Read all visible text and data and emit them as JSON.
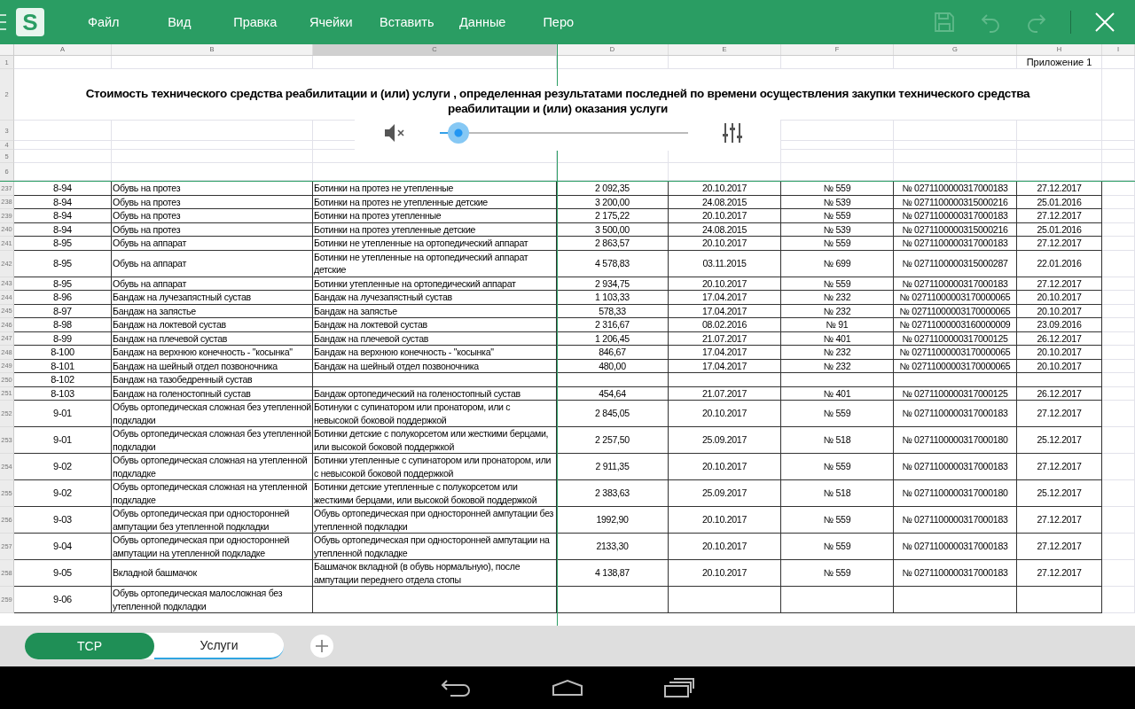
{
  "toolbar": {
    "logo": "S",
    "menu": [
      "Файл",
      "Вид",
      "Правка",
      "Ячейки",
      "Вставить",
      "Данные",
      "Перо"
    ],
    "actions": [
      {
        "kind": "save",
        "disabled": true
      },
      {
        "kind": "undo",
        "disabled": true
      },
      {
        "kind": "redo",
        "disabled": true
      },
      {
        "kind": "close",
        "disabled": false
      }
    ]
  },
  "sheet": {
    "columns": [
      {
        "label": "A",
        "selected": false
      },
      {
        "label": "B",
        "selected": false
      },
      {
        "label": "C",
        "selected": true
      },
      {
        "label": "D",
        "selected": false
      },
      {
        "label": "E",
        "selected": false
      },
      {
        "label": "F",
        "selected": false
      },
      {
        "label": "G",
        "selected": false
      },
      {
        "label": "H",
        "selected": false
      },
      {
        "label": "I",
        "selected": false
      }
    ],
    "top_rows": [
      "1",
      "2",
      "3",
      "4",
      "5",
      "6"
    ],
    "appendix_note": "Приложение 1",
    "title": "Стоимость технического средства реабилитации и (или) услуги , определенная результатами последней по времени осуществления закупки технического средства реабилитации и (или) оказания услуги",
    "rows": [
      {
        "row": "237",
        "cells": {
          "A": "8-94",
          "B": "Обувь на протез",
          "C": "Ботинки на протез не утепленные",
          "D": "2 092,35",
          "E": "20.10.2017",
          "F": "№ 559",
          "G": "№ 0271100000317000183",
          "H": "27.12.2017"
        }
      },
      {
        "row": "238",
        "cells": {
          "A": "8-94",
          "B": "Обувь на протез",
          "C": "Ботинки на протез не утепленные детские",
          "D": "3 200,00",
          "E": "24.08.2015",
          "F": "№ 539",
          "G": "№ 0271100000315000216",
          "H": "25.01.2016"
        }
      },
      {
        "row": "239",
        "cells": {
          "A": "8-94",
          "B": "Обувь на протез",
          "C": "Ботинки на протез утепленные",
          "D": "2 175,22",
          "E": "20.10.2017",
          "F": "№ 559",
          "G": "№ 0271100000317000183",
          "H": "27.12.2017"
        }
      },
      {
        "row": "240",
        "cells": {
          "A": "8-94",
          "B": "Обувь на протез",
          "C": "Ботинки на протез утепленные детские",
          "D": "3 500,00",
          "E": "24.08.2015",
          "F": "№ 539",
          "G": "№ 0271100000315000216",
          "H": "25.01.2016"
        }
      },
      {
        "row": "241",
        "cells": {
          "A": "8-95",
          "B": "Обувь на аппарат",
          "C": "Ботинки не утепленные на ортопедический аппарат",
          "D": "2 863,57",
          "E": "20.10.2017",
          "F": "№ 559",
          "G": "№ 0271100000317000183",
          "H": "27.12.2017"
        }
      },
      {
        "row": "242",
        "cells": {
          "A": "8-95",
          "B": "Обувь на аппарат",
          "C": "Ботинки не утепленные на ортопедический аппарат детские",
          "D": "4 578,83",
          "E": "03.11.2015",
          "F": "№ 699",
          "G": "№ 0271100000315000287",
          "H": "22.01.2016"
        }
      },
      {
        "row": "243",
        "cells": {
          "A": "8-95",
          "B": "Обувь на аппарат",
          "C": "Ботинки утепленные на ортопедический аппарат",
          "D": "2 934,75",
          "E": "20.10.2017",
          "F": "№ 559",
          "G": "№ 0271100000317000183",
          "H": "27.12.2017"
        }
      },
      {
        "row": "244",
        "cells": {
          "A": "8-96",
          "B": "Бандаж на лучезапястный сустав",
          "C": "Бандаж на лучезапястный сустав",
          "D": "1 103,33",
          "E": "17.04.2017",
          "F": "№ 232",
          "G": "№ 02711000003170000065",
          "H": "20.10.2017"
        }
      },
      {
        "row": "245",
        "cells": {
          "A": "8-97",
          "B": "Бандаж на запястье",
          "C": "Бандаж на запястье",
          "D": "578,33",
          "E": "17.04.2017",
          "F": "№ 232",
          "G": "№ 02711000003170000065",
          "H": "20.10.2017"
        }
      },
      {
        "row": "246",
        "cells": {
          "A": "8-98",
          "B": "Бандаж на локтевой сустав",
          "C": "Бандаж на локтевой сустав",
          "D": "2 316,67",
          "E": "08.02.2016",
          "F": "№ 91",
          "G": "№ 02711000003160000009",
          "H": "23.09.2016"
        }
      },
      {
        "row": "247",
        "cells": {
          "A": "8-99",
          "B": "Бандаж на плечевой сустав",
          "C": "Бандаж на плечевой сустав",
          "D": "1 206,45",
          "E": "21.07.2017",
          "F": "№ 401",
          "G": "№ 0271100000317000125",
          "H": "26.12.2017"
        }
      },
      {
        "row": "248",
        "cells": {
          "A": "8-100",
          "B": "Бандаж на верхнюю конечность - \"косынка\"",
          "C": "Бандаж на верхнюю конечность - \"косынка\"",
          "D": "846,67",
          "E": "17.04.2017",
          "F": "№ 232",
          "G": "№ 02711000003170000065",
          "H": "20.10.2017"
        }
      },
      {
        "row": "249",
        "cells": {
          "A": "8-101",
          "B": "Бандаж на шейный отдел позвоночника",
          "C": "Бандаж на шейный отдел позвоночника",
          "D": "480,00",
          "E": "17.04.2017",
          "F": "№ 232",
          "G": "№ 02711000003170000065",
          "H": "20.10.2017"
        }
      },
      {
        "row": "250",
        "cells": {
          "A": "8-102",
          "B": "Бандаж на тазобедренный сустав"
        }
      },
      {
        "row": "251",
        "cells": {
          "A": "8-103",
          "B": "Бандаж на голеностопный сустав",
          "C": "Бандаж ортопедический на голеностопный сустав",
          "D": "454,64",
          "E": "21.07.2017",
          "F": "№ 401",
          "G": "№ 0271100000317000125",
          "H": "26.12.2017"
        }
      },
      {
        "row": "252",
        "cells": {
          "A": "9-01",
          "B": "Обувь ортопедическая сложная без утепленной подкладки",
          "C": "Ботинуки с супинатором или пронатором, или с невысокой боковой поддержкой",
          "D": "2 845,05",
          "E": "20.10.2017",
          "F": "№ 559",
          "G": "№ 0271100000317000183",
          "H": "27.12.2017"
        }
      },
      {
        "row": "253",
        "cells": {
          "A": "9-01",
          "B": "Обувь ортопедическая сложная без утепленной подкладки",
          "C": "Ботинки детские с полукорсетом или жесткими берцами, или высокой боковой поддержкой",
          "D": "2 257,50",
          "E": "25.09.2017",
          "F": "№ 518",
          "G": "№ 0271100000317000180",
          "H": "25.12.2017"
        }
      },
      {
        "row": "254",
        "cells": {
          "A": "9-02",
          "B": "Обувь ортопедическая сложная на утепленной подкладке",
          "C": "Ботинки утепленные с супинатором или пронатором, или с невысокой боковой поддержкой",
          "D": "2 911,35",
          "E": "20.10.2017",
          "F": "№ 559",
          "G": "№ 0271100000317000183",
          "H": "27.12.2017"
        }
      },
      {
        "row": "255",
        "cells": {
          "A": "9-02",
          "B": "Обувь ортопедическая сложная на утепленной подкладке",
          "C": "Ботинки детские утепленные с полукорсетом или жесткими берцами, или высокой боковой поддержкой",
          "D": "2 383,63",
          "E": "25.09.2017",
          "F": "№ 518",
          "G": "№ 0271100000317000180",
          "H": "25.12.2017"
        }
      },
      {
        "row": "256",
        "cells": {
          "A": "9-03",
          "B": "Обувь ортопедическая при односторонней ампутации без утепленной подкладки",
          "C": "Обувь ортопедическая при односторонней ампутации без утепленной подкладки",
          "D": "1992,90",
          "E": "20.10.2017",
          "F": "№ 559",
          "G": "№ 0271100000317000183",
          "H": "27.12.2017"
        }
      },
      {
        "row": "257",
        "cells": {
          "A": "9-04",
          "B": "Обувь ортопедическая при односторонней ампутации на утепленной подкладке",
          "C": "Обувь ортопедическая при односторонней ампутации на утепленной подкладке",
          "D": "2133,30",
          "E": "20.10.2017",
          "F": "№ 559",
          "G": "№ 0271100000317000183",
          "H": "27.12.2017"
        }
      },
      {
        "row": "258",
        "cells": {
          "A": "9-05",
          "B": "Вкладной башмачок",
          "C": "Башмачок вкладной (в обувь нормальную), после ампутации переднего отдела стопы",
          "D": "4 138,87",
          "E": "20.10.2017",
          "F": "№ 559",
          "G": "№ 0271100000317000183",
          "H": "27.12.2017"
        }
      },
      {
        "row": "259",
        "cells": {
          "A": "9-06",
          "B": "Обувь ортопедическая малосложная без утепленной подкладки"
        }
      }
    ]
  },
  "media_overlay": {
    "muted": true,
    "level": 0.04
  },
  "sheet_tabs": [
    {
      "label": "ТСР",
      "selected": true
    },
    {
      "label": "Услуги",
      "selected": false
    }
  ]
}
